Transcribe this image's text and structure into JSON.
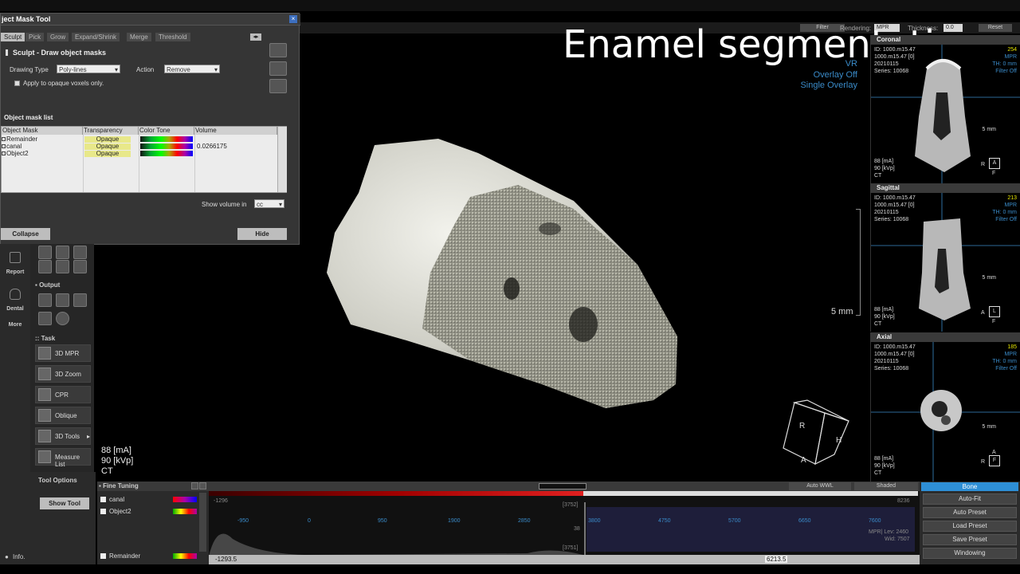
{
  "dialog": {
    "title": "ject Mask Tool",
    "close": "×",
    "tabs": [
      "Sculpt",
      "Pick",
      "Grow",
      "Expand/Shrink",
      "Merge",
      "Threshold"
    ],
    "section_title": "Sculpt - Draw object masks",
    "drawing_type_label": "Drawing Type",
    "drawing_type_value": "Poly-lines",
    "action_label": "Action",
    "action_value": "Remove",
    "opaque_only_label": "Apply to opaque voxels only.",
    "list_title": "Object mask list",
    "columns": [
      "Object Mask",
      "Transparency",
      "Color Tone",
      "Volume"
    ],
    "rows": [
      {
        "name": "Remainder",
        "transparency": "Opaque",
        "volume": ""
      },
      {
        "name": "canal",
        "transparency": "Opaque",
        "volume": "0.0266175"
      },
      {
        "name": "Object2",
        "transparency": "Opaque",
        "volume": ""
      }
    ],
    "show_volume_label": "Show volume in",
    "show_volume_unit": "cc",
    "collapse_label": "Collapse",
    "hide_label": "Hide"
  },
  "toolbar": {
    "filter": "Filter",
    "rendering_label": "Rendering:",
    "rendering_value": "MPR",
    "thickness_label": "Thickness:",
    "thickness_value": "0.0",
    "reset": "Reset"
  },
  "sidebar": {
    "report": "Report",
    "dental": "Dental",
    "more": "More",
    "output": "Output",
    "task": "Task",
    "tasks": [
      "3D MPR",
      "3D Zoom",
      "CPR",
      "Oblique",
      "3D Tools",
      "Measure List"
    ],
    "tool_options": "Tool Options",
    "show_tool": "Show Tool"
  },
  "view3d": {
    "title": "Enamel segmentation",
    "vr": "VR",
    "overlay_off": "Overlay Off",
    "single_overlay": "Single Overlay",
    "scale": "5 mm",
    "ma": "88 [mA]",
    "kvp": "90 [kVp]",
    "modality": "CT",
    "cube_r": "R",
    "cube_a": "A",
    "cube_h": "H"
  },
  "panels": [
    {
      "title": "Coronal",
      "id": "ID: 1000.m15.47",
      "sub": "1000.m15.47 [0]",
      "date": "20210115",
      "series": "Series: 10068",
      "num": "254",
      "mpr": "MPR",
      "th": "TH: 0 mm",
      "filter": "Filter Off",
      "scale": "5 mm",
      "ma": "88 [mA]",
      "kvp": "90 [kVp]",
      "ct": "CT",
      "orient_l": "R",
      "orient_box": "A",
      "orient_b": "F"
    },
    {
      "title": "Sagittal",
      "id": "ID: 1000.m15.47",
      "sub": "1000.m15.47 [0]",
      "date": "20210115",
      "series": "Series: 10068",
      "num": "213",
      "mpr": "MPR",
      "th": "TH: 0 mm",
      "filter": "Filter Off",
      "scale": "5 mm",
      "ma": "88 [mA]",
      "kvp": "90 [kVp]",
      "ct": "CT",
      "orient_l": "A",
      "orient_box": "L",
      "orient_b": "F"
    },
    {
      "title": "Axial",
      "id": "ID: 1000.m15.47",
      "sub": "1000.m15.47 [0]",
      "date": "20210115",
      "series": "Series: 10068",
      "num": "185",
      "mpr": "MPR",
      "th": "TH: 0 mm",
      "filter": "Filter Off",
      "scale": "5 mm",
      "ma": "88 [mA]",
      "kvp": "90 [kVp]",
      "ct": "CT",
      "orient_l": "R",
      "orient_box": "F",
      "orient_b": "A"
    }
  ],
  "fine_tuning": {
    "title": "Fine Tuning",
    "items": [
      "canal",
      "Object2",
      "Remainder"
    ]
  },
  "histogram": {
    "ticks": [
      "-950",
      "0",
      "950",
      "1900",
      "2850",
      "3800",
      "4750",
      "5700",
      "6650",
      "7600"
    ],
    "min": "-1296",
    "max": "8236",
    "left_val": "-1293.5",
    "right_val": "6213.5",
    "marker_top": "[3752]",
    "marker_mid": "38",
    "marker_bot": "[3751]",
    "lev": "MPR| Lev: 2460",
    "wid": "Wid: 7507",
    "auto_wwl": "Auto WWL",
    "shaded": "Shaded"
  },
  "presets": {
    "bone": "Bone",
    "items": [
      "Auto-Fit",
      "Auto Preset",
      "Load Preset",
      "Save Preset",
      "Windowing"
    ]
  },
  "status": {
    "info": "Info."
  },
  "colors": {
    "accent_blue": "#3a8bc9",
    "highlight": "#e5e500"
  }
}
